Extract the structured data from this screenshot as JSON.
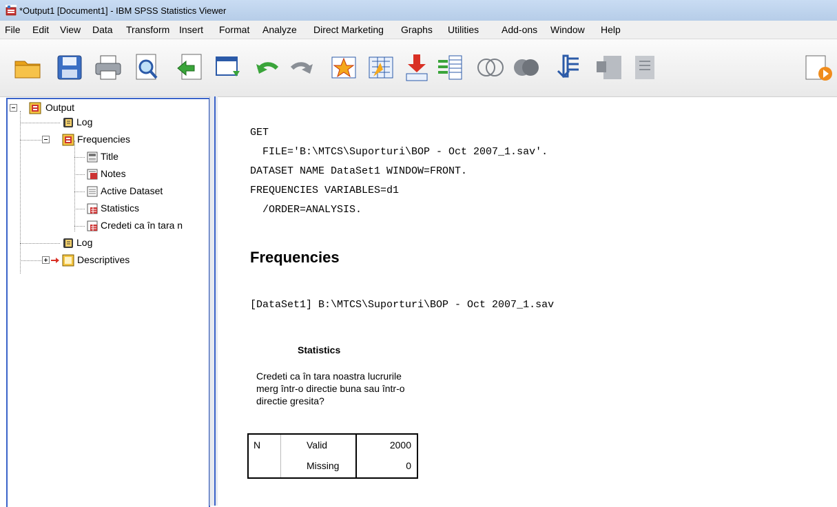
{
  "window": {
    "title": "*Output1 [Document1] - IBM SPSS Statistics Viewer"
  },
  "menu": [
    "File",
    "Edit",
    "View",
    "Data",
    "Transform",
    "Insert",
    "Format",
    "Analyze",
    "Direct Marketing",
    "Graphs",
    "Utilities",
    "Add-ons",
    "Window",
    "Help"
  ],
  "toolbar_icons": [
    "open-folder-icon",
    "save-icon",
    "print-icon",
    "print-preview-icon",
    "export-icon",
    "recall-dialog-icon",
    "undo-icon",
    "redo-icon",
    "goto-data-icon",
    "goto-case-icon",
    "goto-variable-icon",
    "variables-icon",
    "show-all-icon",
    "hide-icon",
    "designate-window-icon",
    "promote-icon",
    "demote-icon",
    "run-script-icon"
  ],
  "outline": {
    "root": "Output",
    "items": [
      {
        "label": "Log"
      },
      {
        "label": "Frequencies"
      },
      {
        "label": "Title"
      },
      {
        "label": "Notes"
      },
      {
        "label": "Active Dataset"
      },
      {
        "label": "Statistics"
      },
      {
        "label": "Credeti ca în tara n"
      },
      {
        "label": "Log"
      },
      {
        "label": "Descriptives"
      }
    ]
  },
  "syntax": [
    "GET",
    "  FILE='B:\\MTCS\\Suporturi\\BOP - Oct 2007_1.sav'.",
    "DATASET NAME DataSet1 WINDOW=FRONT.",
    "FREQUENCIES VARIABLES=d1",
    "  /ORDER=ANALYSIS."
  ],
  "heading": "Frequencies",
  "dataset_line": "[DataSet1] B:\\MTCS\\Suporturi\\BOP - Oct 2007_1.sav",
  "statistics": {
    "title": "Statistics",
    "variable_label": "Credeti ca în tara noastra lucrurile merg într-o directie buna sau într-o directie gresita?",
    "row_header": "N",
    "rows": [
      {
        "label": "Valid",
        "value": "2000"
      },
      {
        "label": "Missing",
        "value": "0"
      }
    ]
  }
}
